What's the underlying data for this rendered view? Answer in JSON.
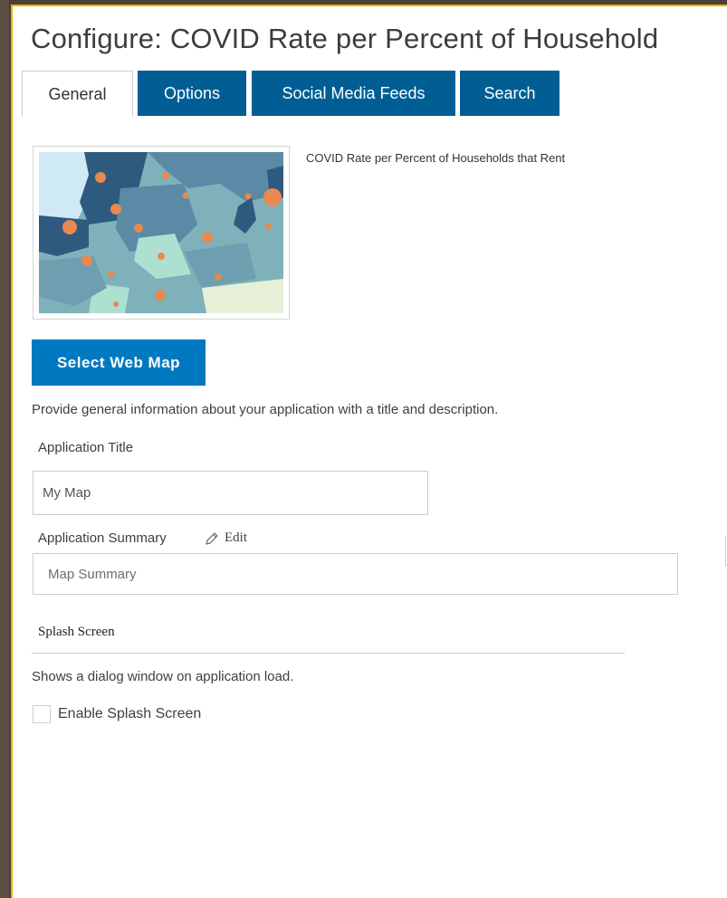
{
  "header": {
    "title": "Configure: COVID Rate per Percent of Household"
  },
  "tabs": [
    {
      "label": "General",
      "active": true
    },
    {
      "label": "Options",
      "active": false
    },
    {
      "label": "Social Media Feeds",
      "active": false
    },
    {
      "label": "Search",
      "active": false
    }
  ],
  "webmap": {
    "name": "COVID Rate per Percent of Households that Rent",
    "select_label": "Select Web Map"
  },
  "general": {
    "intro": "Provide general information about your application with a title and description.",
    "title_label": "Application Title",
    "title_value": "My Map",
    "summary_label": "Application Summary",
    "edit_label": "Edit",
    "summary_placeholder": "Map Summary"
  },
  "splash": {
    "heading": "Splash Screen",
    "description": "Shows a dialog window on application load.",
    "checkbox_label": "Enable Splash Screen",
    "checked": false
  },
  "colors": {
    "accent_border": "#e8b400",
    "tab_blue": "#005e95",
    "button_blue": "#0079c1",
    "map_dark": "#2f5a80",
    "map_mid": "#5a8aa6",
    "map_light": "#8fbfc4",
    "map_water": "#cfe9f5",
    "point_orange": "#e8894e"
  }
}
